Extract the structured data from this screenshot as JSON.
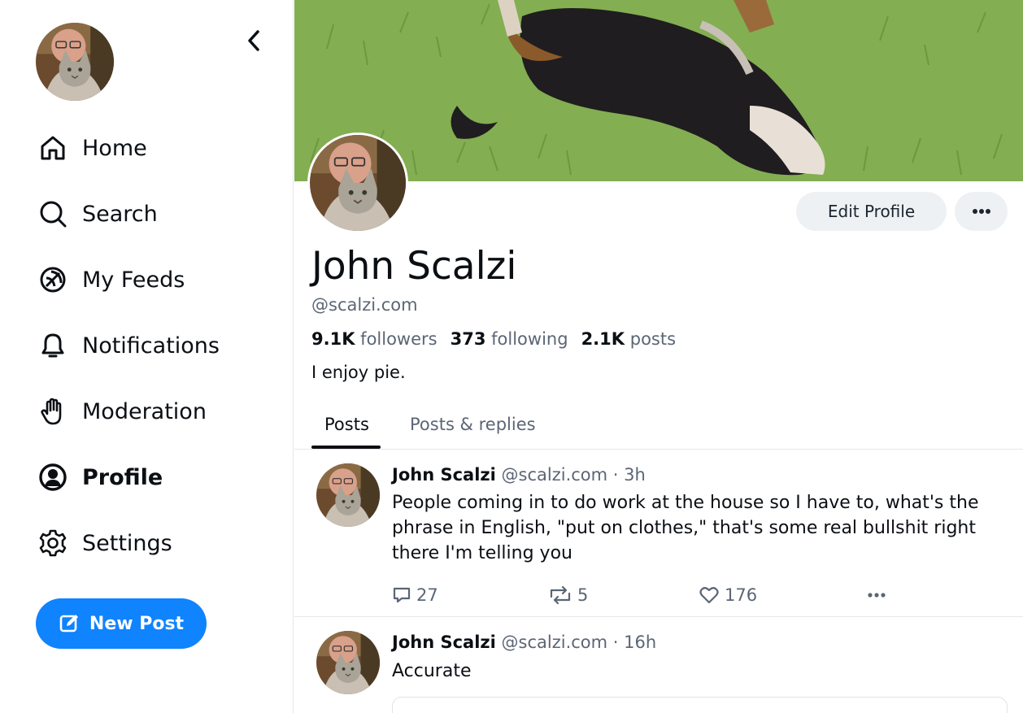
{
  "sidebar": {
    "items": [
      {
        "label": "Home",
        "icon": "home-icon",
        "active": false
      },
      {
        "label": "Search",
        "icon": "search-icon",
        "active": false
      },
      {
        "label": "My Feeds",
        "icon": "feeds-icon",
        "active": false
      },
      {
        "label": "Notifications",
        "icon": "bell-icon",
        "active": false
      },
      {
        "label": "Moderation",
        "icon": "hand-icon",
        "active": false
      },
      {
        "label": "Profile",
        "icon": "user-circle-icon",
        "active": true
      },
      {
        "label": "Settings",
        "icon": "gear-icon",
        "active": false
      }
    ],
    "new_post_label": "New Post"
  },
  "profile": {
    "display_name": "John Scalzi",
    "handle": "@scalzi.com",
    "followers_count": "9.1K",
    "followers_label": "followers",
    "following_count": "373",
    "following_label": "following",
    "posts_count": "2.1K",
    "posts_label": "posts",
    "bio": "I enjoy pie.",
    "edit_label": "Edit Profile"
  },
  "tabs": [
    {
      "label": "Posts",
      "active": true
    },
    {
      "label": "Posts & replies",
      "active": false
    }
  ],
  "posts": [
    {
      "author": "John Scalzi",
      "handle": "@scalzi.com",
      "time": "· 3h",
      "text": "People coming in to do work at the house so I have to, what's the phrase in English, \"put on clothes,\" that's some real bullshit right there I'm telling you",
      "replies": "27",
      "reposts": "5",
      "likes": "176"
    },
    {
      "author": "John Scalzi",
      "handle": "@scalzi.com",
      "time": "· 16h",
      "text": "Accurate"
    }
  ],
  "colors": {
    "accent": "#1083fe",
    "text": "#0b0f14",
    "muted": "#5b6675",
    "button_bg": "#eef1f4",
    "border": "#e4e7eb"
  }
}
